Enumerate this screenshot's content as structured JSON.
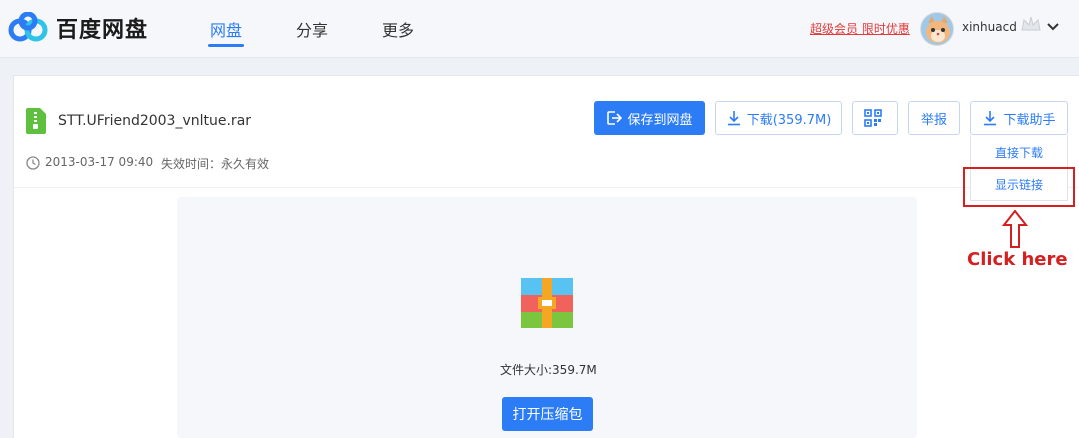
{
  "header": {
    "logo_text": "百度网盘",
    "tabs": [
      {
        "label": "网盘",
        "active": true
      },
      {
        "label": "分享",
        "active": false
      },
      {
        "label": "更多",
        "active": false
      }
    ],
    "promo_text": "超级会员 限时优惠",
    "username": "xinhuacd"
  },
  "file": {
    "name": "STT.UFriend2003_vnltue.rar",
    "date": "2013-03-17 09:40",
    "expire": "失效时间：永久有效",
    "size_text": "文件大小:359.7M"
  },
  "toolbar": {
    "save_label": "保存到网盘",
    "download_label": "下载(359.7M)",
    "report_label": "举报",
    "helper_label": "下载助手"
  },
  "dropdown": {
    "items": [
      {
        "label": "直接下载"
      },
      {
        "label": "显示链接"
      }
    ]
  },
  "annotation": {
    "text": "Click here"
  },
  "preview": {
    "open_label": "打开压缩包"
  },
  "colors": {
    "accent": "#2c7cf6",
    "annotation": "#d42020"
  }
}
